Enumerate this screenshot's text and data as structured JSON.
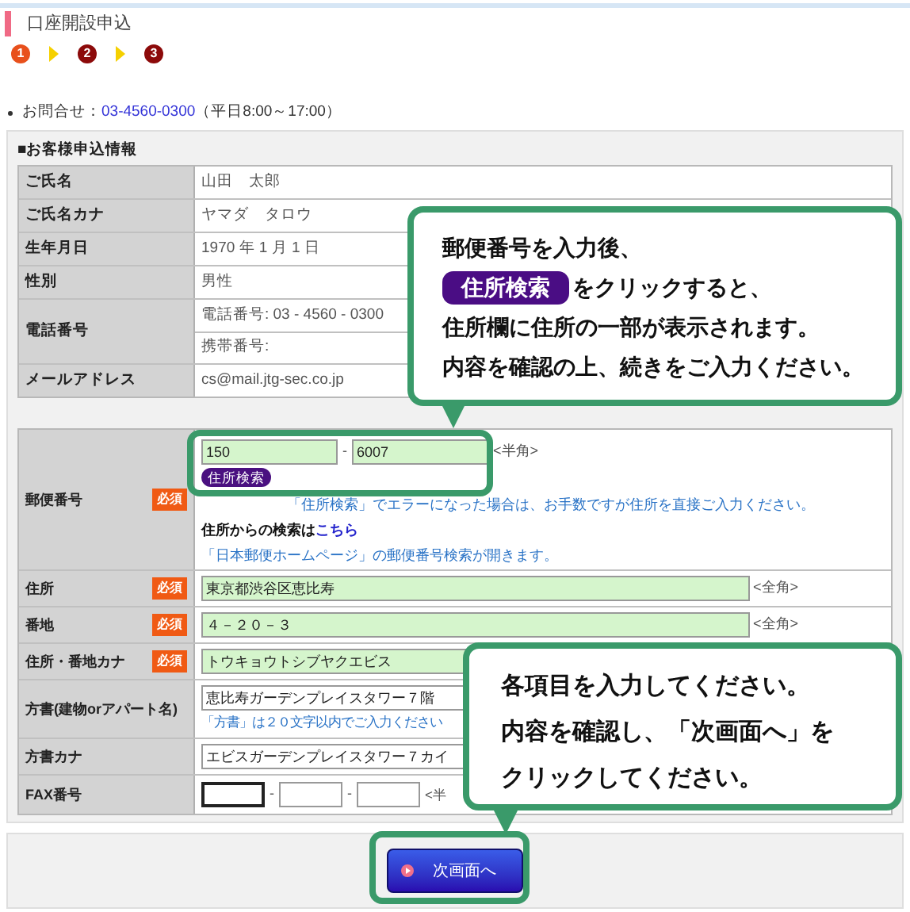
{
  "page_title": "口座開設申込",
  "steps": [
    {
      "label": "1",
      "selected": true
    },
    {
      "label": "2",
      "selected": false
    },
    {
      "label": "3",
      "selected": false
    }
  ],
  "contact": {
    "label": "お問合せ：",
    "phone": "03-4560-0300",
    "hours": "（平日8:00～17:00）"
  },
  "section_title": "■お客様申込情報",
  "customer_rows": [
    {
      "label": "ご氏名",
      "values": [
        "山田　太郎"
      ]
    },
    {
      "label": "ご氏名カナ",
      "values": [
        "ヤマダ　タロウ"
      ]
    },
    {
      "label": "生年月日",
      "values": [
        "1970 年 1 月 1 日"
      ]
    },
    {
      "label": "性別",
      "values": [
        "男性"
      ]
    },
    {
      "label": "電話番号",
      "values": [
        "電話番号: 03 - 4560 - 0300",
        "携帯番号:"
      ]
    },
    {
      "label": "メールアドレス",
      "values": [
        "cs@mail.jtg-sec.co.jp"
      ]
    }
  ],
  "address_rows": [
    {
      "kind": "postal",
      "label": "郵便番号",
      "badge": "必須",
      "fields": [
        "150",
        "6007"
      ],
      "separator": "-",
      "unit": "<半角>",
      "button": "住所検索",
      "note": "「住所検索」でエラーになった場合は、お手数ですが住所を直接ご入力ください。",
      "search_label": "住所からの検索は",
      "search_link": "こちら",
      "link_note": "「日本郵便ホームページ」の郵便番号検索が開きます。"
    },
    {
      "kind": "input",
      "label": "住所",
      "badge": "必須",
      "value": "東京都渋谷区恵比寿",
      "highlighted": true,
      "unit": "<全角>"
    },
    {
      "kind": "input",
      "label": "番地",
      "badge": "必須",
      "value": "４－２０－３",
      "highlighted": true,
      "unit": "<全角>"
    },
    {
      "kind": "input",
      "label": "住所・番地カナ",
      "badge": "必須",
      "value": "トウキョウトシブヤクエビス",
      "highlighted": true
    },
    {
      "kind": "input",
      "label": "方書(建物orアパート名)",
      "value": "恵比寿ガーデンプレイスタワー７階",
      "highlighted": false,
      "note": "「方書」は２０文字以内でご入力ください"
    },
    {
      "kind": "input",
      "label": "方書カナ",
      "value": "エビスガーデンプレイスタワー７カイ",
      "highlighted": false
    },
    {
      "kind": "fax",
      "label": "FAX番号",
      "fax_fields": [
        {
          "focused": true
        },
        {
          "focused": false
        },
        {
          "focused": false
        }
      ],
      "separator": "-",
      "unit": "<半"
    }
  ],
  "next_button": "次画面へ",
  "callouts": [
    {
      "lines": [
        "郵便番号を入力後、",
        "をクリックすると、",
        "住所欄に住所の一部が表示されます。",
        "内容を確認の上、続きをご入力ください。"
      ],
      "pill": "住所検索"
    },
    {
      "lines": [
        "各項目を入力してください。",
        "内容を確認し、「次画面へ」を",
        "クリックしてください。"
      ]
    }
  ]
}
